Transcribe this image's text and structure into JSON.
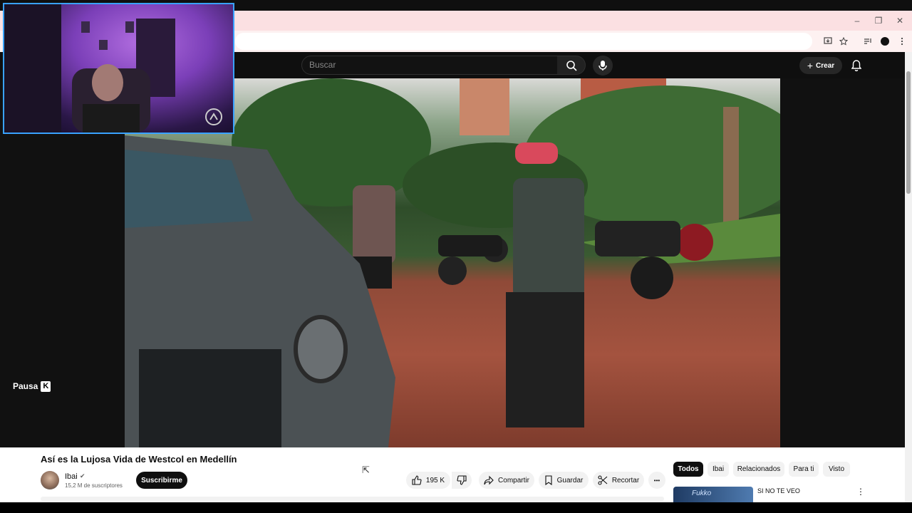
{
  "browser": {
    "window_controls": {
      "minimize": "–",
      "maximize": "❐",
      "close": "✕"
    }
  },
  "youtube_header": {
    "search": {
      "placeholder": "Buscar"
    },
    "create_label": "Crear"
  },
  "player": {
    "tooltip": {
      "label": "Pausa",
      "shortcut": "K"
    }
  },
  "video": {
    "title": "Así es la Lujosa Vida de Westcol en Medellín",
    "channel": {
      "name": "Ibai",
      "subscribers": "15,2 M de suscriptores",
      "subscribe_label": "Suscribirme"
    },
    "actions": {
      "likes": "195 K",
      "share_label": "Compartir",
      "save_label": "Guardar",
      "clip_label": "Recortar",
      "more_label": "•••"
    }
  },
  "recommendations": {
    "chips": [
      "Todos",
      "Ibai",
      "Relacionados",
      "Para ti",
      "Visto"
    ],
    "active_chip": "Todos",
    "items": [
      {
        "title": "SI NO TE VEO",
        "thumbnail_text": "Fukko"
      }
    ]
  },
  "colors": {
    "accent_blue_border": "#39a2ff",
    "tabstrip": "#fbe0e2",
    "youtube_dark": "#0f0f0f"
  }
}
